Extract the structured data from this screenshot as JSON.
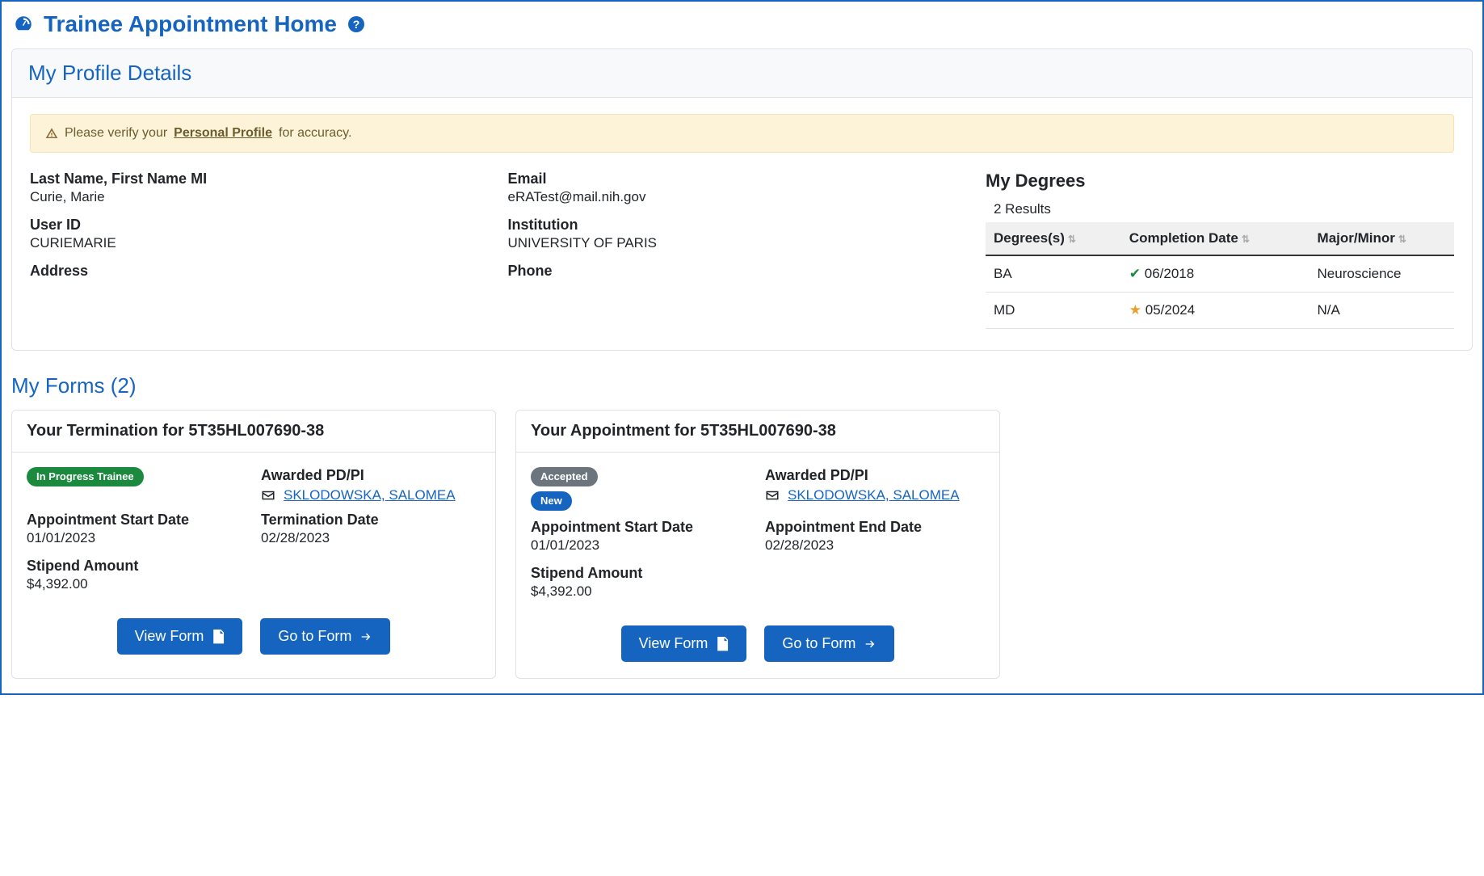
{
  "page": {
    "title": "Trainee Appointment Home"
  },
  "profile": {
    "panel_title": "My Profile Details",
    "alert_prefix": "Please verify your ",
    "alert_link": "Personal Profile",
    "alert_suffix": " for accuracy.",
    "labels": {
      "name": "Last Name, First Name MI",
      "user_id": "User ID",
      "address": "Address",
      "email": "Email",
      "institution": "Institution",
      "phone": "Phone"
    },
    "values": {
      "name": "Curie, Marie",
      "user_id": "CURIEMARIE",
      "address": "",
      "email": "eRATest@mail.nih.gov",
      "institution": "UNIVERSITY OF PARIS",
      "phone": ""
    },
    "degrees": {
      "title": "My Degrees",
      "results_text": "2 Results",
      "columns": {
        "degree": "Degrees(s)",
        "completion": "Completion Date",
        "major": "Major/Minor"
      },
      "rows": [
        {
          "degree": "BA",
          "status_icon": "check",
          "completion": "06/2018",
          "major": "Neuroscience"
        },
        {
          "degree": "MD",
          "status_icon": "star",
          "completion": "05/2024",
          "major": "N/A"
        }
      ]
    }
  },
  "forms_section": {
    "title": "My Forms (2)"
  },
  "forms": [
    {
      "title": "Your Termination for 5T35HL007690-38",
      "badges": [
        {
          "text": "In Progress Trainee",
          "cls": "badge-green"
        }
      ],
      "pdpi_label": "Awarded PD/PI",
      "pdpi_name": "SKLODOWSKA, SALOMEA",
      "left": [
        {
          "label": "Appointment Start Date",
          "value": "01/01/2023"
        },
        {
          "label": "Stipend Amount",
          "value": "$4,392.00"
        }
      ],
      "right": [
        {
          "label": "Termination Date",
          "value": "02/28/2023"
        }
      ],
      "buttons": {
        "view": "View Form",
        "go": "Go to Form"
      }
    },
    {
      "title": "Your Appointment for 5T35HL007690-38",
      "badges": [
        {
          "text": "Accepted",
          "cls": "badge-gray"
        },
        {
          "text": "New",
          "cls": "badge-blue"
        }
      ],
      "pdpi_label": "Awarded PD/PI",
      "pdpi_name": "SKLODOWSKA, SALOMEA",
      "left": [
        {
          "label": "Appointment Start Date",
          "value": "01/01/2023"
        },
        {
          "label": "Stipend Amount",
          "value": "$4,392.00"
        }
      ],
      "right": [
        {
          "label": "Appointment End Date",
          "value": "02/28/2023"
        }
      ],
      "buttons": {
        "view": "View Form",
        "go": "Go to Form"
      }
    }
  ]
}
